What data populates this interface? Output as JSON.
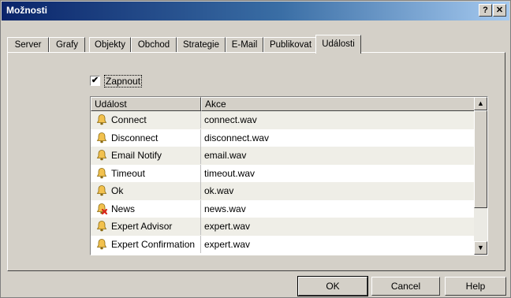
{
  "window": {
    "title": "Možnosti",
    "help_button": "?",
    "close_button": "✕"
  },
  "tabs": [
    {
      "label": "Server"
    },
    {
      "label": "Grafy"
    },
    {
      "label": "Objekty"
    },
    {
      "label": "Obchod"
    },
    {
      "label": "Strategie"
    },
    {
      "label": "E-Mail"
    },
    {
      "label": "Publikovat"
    },
    {
      "label": "Události",
      "active": true
    }
  ],
  "enable_checkbox": {
    "label": "Zapnout",
    "checked": true,
    "check_glyph": "✔"
  },
  "events_table": {
    "columns": [
      "Událost",
      "Akce"
    ],
    "rows": [
      {
        "event": "Connect",
        "action": "connect.wav",
        "icon": "bell-icon"
      },
      {
        "event": "Disconnect",
        "action": "disconnect.wav",
        "icon": "bell-icon"
      },
      {
        "event": "Email Notify",
        "action": "email.wav",
        "icon": "bell-icon"
      },
      {
        "event": "Timeout",
        "action": "timeout.wav",
        "icon": "bell-icon"
      },
      {
        "event": "Ok",
        "action": "ok.wav",
        "icon": "bell-icon"
      },
      {
        "event": "News",
        "action": "news.wav",
        "icon": "bell-disabled-icon"
      },
      {
        "event": "Expert Advisor",
        "action": "expert.wav",
        "icon": "bell-icon"
      },
      {
        "event": "Expert Confirmation",
        "action": "expert.wav",
        "icon": "bell-icon"
      }
    ]
  },
  "scrollbar": {
    "up_glyph": "▲",
    "down_glyph": "▼"
  },
  "buttons": {
    "ok": "OK",
    "cancel": "Cancel",
    "help": "Help"
  },
  "colors": {
    "titlebar_start": "#0a246a",
    "titlebar_end": "#a6caf0",
    "face": "#d4d0c8",
    "bell": "#f2c14e",
    "disabled_x": "#d9261c"
  }
}
